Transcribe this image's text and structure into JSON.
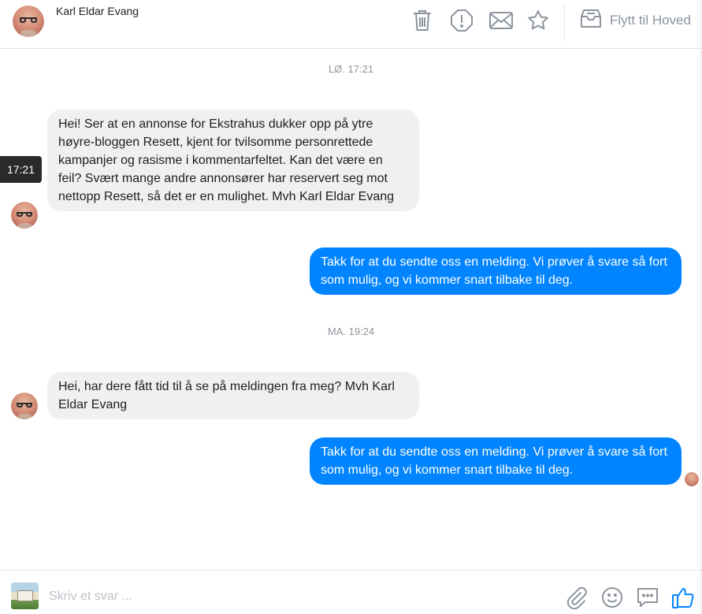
{
  "header": {
    "contact_name": "Karl Eldar Evang",
    "icons": [
      "trash-icon",
      "alert-octagon-icon",
      "envelope-icon",
      "star-icon",
      "inbox-tray-icon"
    ],
    "move_label": "Flytt til Hoved"
  },
  "messages": {
    "timestamp_1": "LØ. 17:21",
    "hover_time": "17:21",
    "incoming_1": "Hei! Ser at en annonse for Ekstrahus dukker opp på ytre høyre-bloggen Resett, kjent for tvilsomme personrettede kampanjer og rasisme i kommentarfeltet. Kan det være en feil? Svært mange andre annonsører har reservert seg mot nettopp Resett, så det er en mulighet. Mvh Karl Eldar Evang",
    "outgoing_1": "Takk for at du sendte oss en melding. Vi prøver å svare så fort som mulig, og vi kommer snart tilbake til deg.",
    "timestamp_2": "MA. 19:24",
    "incoming_2": "Hei, har dere fått tid til å se på meldingen fra meg? Mvh Karl Eldar Evang",
    "outgoing_2": "Takk for at du sendte oss en melding. Vi prøver å svare så fort som mulig, og vi kommer snart tilbake til deg."
  },
  "composer": {
    "placeholder": "Skriv et svar ...",
    "icons": [
      "paperclip-icon",
      "smiley-icon",
      "saved-reply-icon",
      "thumbs-up-icon"
    ]
  },
  "colors": {
    "accent": "#0084ff",
    "incoming_bubble": "#f1f0f0",
    "icon_gray": "#8d949e"
  }
}
